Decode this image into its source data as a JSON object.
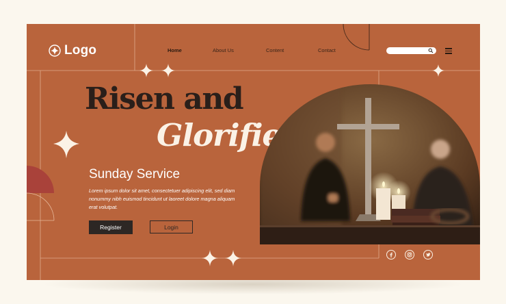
{
  "brand": {
    "logo_text": "Logo"
  },
  "nav": {
    "items": [
      "Home",
      "About Us",
      "Content",
      "Contact"
    ]
  },
  "search": {
    "placeholder": ""
  },
  "hero": {
    "headline_line1": "Risen and",
    "headline_line2": "Glorified",
    "subtitle": "Sunday Service",
    "body": "Lorem ipsum dolor sit amet, consectetuer adipiscing elit, sed diam nonummy nibh euismod tincidunt ut laoreet dolore magna aliquam erat volutpat.",
    "register_label": "Register",
    "login_label": "Login"
  },
  "social": {
    "icons": [
      "facebook-icon",
      "instagram-icon",
      "twitter-icon"
    ]
  },
  "colors": {
    "card_bg": "#b9643c",
    "page_bg": "#fbf7ee",
    "dark_text": "#2a1f1a",
    "light_text": "#fbf2e6",
    "accent_red": "#a9423a"
  }
}
